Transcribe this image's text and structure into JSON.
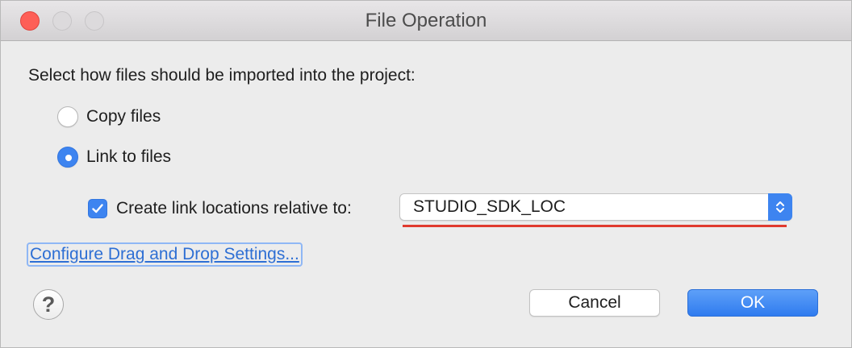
{
  "window": {
    "title": "File Operation"
  },
  "prompt": "Select how files should be imported into the project:",
  "options": {
    "copy_label": "Copy files",
    "link_label": "Link to files",
    "selected": "Link to files"
  },
  "relative": {
    "checkbox_label": "Create link locations relative to:",
    "checked": true,
    "select_value": "STUDIO_SDK_LOC"
  },
  "link_text": "Configure Drag and Drop Settings...",
  "buttons": {
    "help": "?",
    "cancel": "Cancel",
    "ok": "OK"
  },
  "colors": {
    "accent": "#3d84f0",
    "close_button": "#fe5f57",
    "annotation_underline": "#e03a2e",
    "link": "#2e6fd4"
  }
}
